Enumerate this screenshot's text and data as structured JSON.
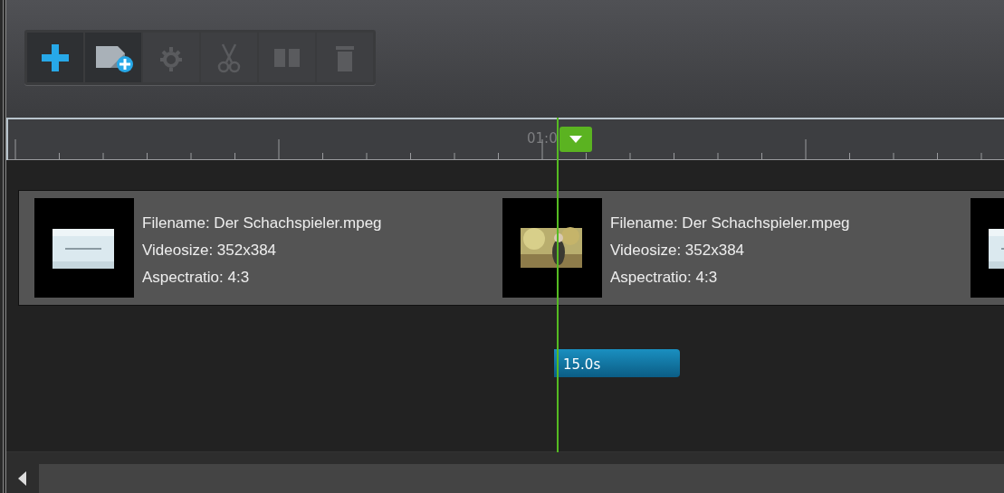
{
  "toolbar": {
    "buttons": [
      {
        "kind": "add",
        "disabled": false
      },
      {
        "kind": "add-media",
        "disabled": false
      },
      {
        "kind": "settings",
        "disabled": true
      },
      {
        "kind": "cut",
        "disabled": true
      },
      {
        "kind": "split",
        "disabled": true
      },
      {
        "kind": "delete",
        "disabled": true
      }
    ]
  },
  "ruler": {
    "label": "01:0"
  },
  "clips": [
    {
      "thumbnail": {
        "kind": "picture"
      },
      "lines": [
        "Filename: Der Schachspieler.mpeg",
        "Videosize: 352x384",
        "Aspectratio: 4:3"
      ]
    },
    {
      "thumbnail": {
        "kind": "picture"
      },
      "lines": [
        "Filename: Der Schachspieler.mpeg",
        "Videosize: 352x384",
        "Aspectratio: 4:3"
      ]
    },
    {
      "thumbnail": {
        "kind": "picture"
      }
    }
  ],
  "duration": {
    "label": "15.0s"
  }
}
